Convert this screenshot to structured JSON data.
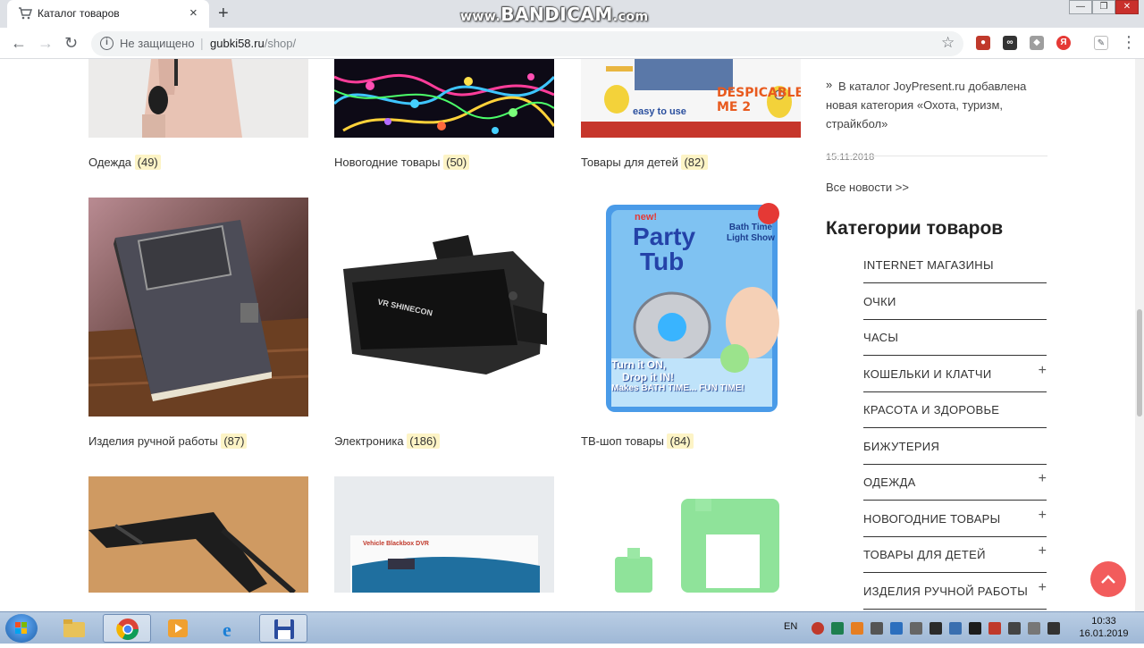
{
  "browser": {
    "tab_title": "Каталог товаров",
    "tab_close": "×",
    "new_tab": "+",
    "watermark_prefix": "www.",
    "watermark_brand": "BANDICAM",
    "watermark_suffix": ".com",
    "security_label": "Не защищено",
    "url_host": "gubki58.ru",
    "url_path": "/shop/"
  },
  "products": [
    {
      "name": "Одежда",
      "count": "(49)"
    },
    {
      "name": "Новогодние товары",
      "count": "(50)"
    },
    {
      "name": "Товары для детей",
      "count": "(82)"
    },
    {
      "name": "Изделия ручной работы",
      "count": "(87)"
    },
    {
      "name": "Электроника",
      "count": "(186)"
    },
    {
      "name": "ТВ-шоп товары",
      "count": "(84)"
    }
  ],
  "product_images": {
    "kids_brand": "DESPICABLE ME 2",
    "kids_tagline": "easy to use",
    "vr_brand": "VR SHINECON",
    "tub_title_1": "Party",
    "tub_title_2": "Tub",
    "tub_new": "new!",
    "tub_badge": "Bath Time Light Show",
    "tub_slogan_1": "Turn it ON,",
    "tub_slogan_2": "Drop it IN!",
    "tub_slogan_3": "Makes BATH TIME... FUN TIME!",
    "dvr_label": "Vehicle Blackbox DVR"
  },
  "news": {
    "arrow": "»",
    "text": "В каталог JoyPresent.ru добавлена новая категория «Охота, туризм, страйкбол»",
    "date": "15.11.2018",
    "all_news": "Все новости >>"
  },
  "categories": {
    "heading": "Категории товаров",
    "items": [
      {
        "label": "INTERNET МАГАЗИНЫ",
        "expand": ""
      },
      {
        "label": "ОЧКИ",
        "expand": ""
      },
      {
        "label": "ЧАСЫ",
        "expand": ""
      },
      {
        "label": "КОШЕЛЬКИ И КЛАТЧИ",
        "expand": "+"
      },
      {
        "label": "КРАСОТА И ЗДОРОВЬЕ",
        "expand": ""
      },
      {
        "label": "БИЖУТЕРИЯ",
        "expand": ""
      },
      {
        "label": "ОДЕЖДА",
        "expand": "+"
      },
      {
        "label": "НОВОГОДНИЕ ТОВАРЫ",
        "expand": "+"
      },
      {
        "label": "ТОВАРЫ ДЛЯ ДЕТЕЙ",
        "expand": "+"
      },
      {
        "label": "ИЗДЕЛИЯ РУЧНОЙ РАБОТЫ",
        "expand": "+"
      }
    ]
  },
  "taskbar": {
    "lang": "EN",
    "time": "10:33",
    "date": "16.01.2019"
  },
  "colors": {
    "accent_red": "#f25c5c",
    "count_highlight": "#fdf4c6"
  }
}
